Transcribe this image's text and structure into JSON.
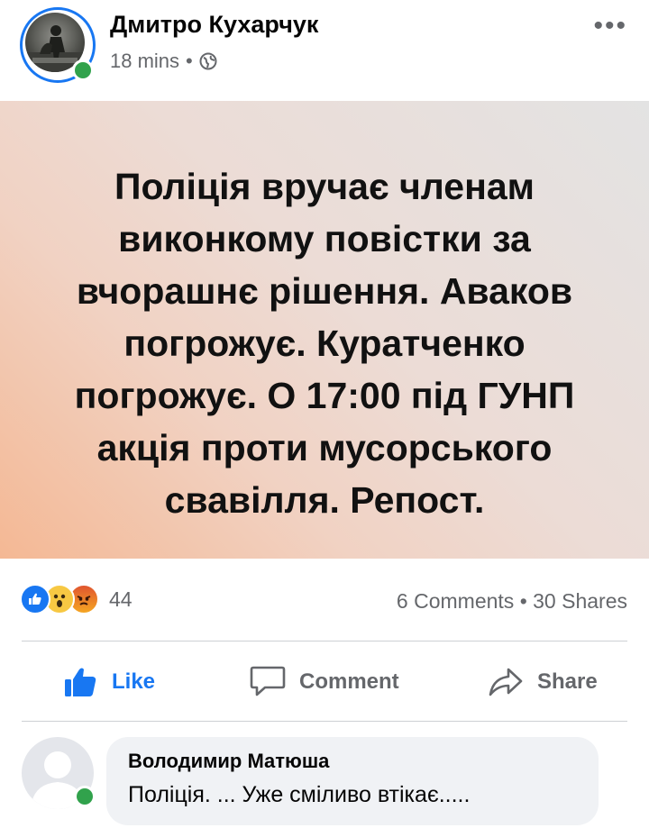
{
  "author": {
    "name": "Дмитро Кухарчук",
    "timestamp": "18 mins",
    "privacy_icon": "globe-icon"
  },
  "post": {
    "text": "Поліція вручає членам виконкому повістки за вчорашнє рішення. Аваков погрожує. Куратченко погрожує. О 17:00 під ГУНП акція проти мусорського свавілля. Репост.",
    "background_gradient": [
      "#f4b894",
      "#ecdcd6",
      "#e3e3e3"
    ]
  },
  "reactions": {
    "types": [
      "like",
      "wow",
      "angry"
    ],
    "count": "44"
  },
  "stats": {
    "comments": "6 Comments",
    "separator": "•",
    "shares": "30 Shares"
  },
  "actions": {
    "like": "Like",
    "comment": "Comment",
    "share": "Share"
  },
  "comment": {
    "author": "Володимир Матюша",
    "text": "Поліція. ... Уже  сміливо втікає....."
  },
  "colors": {
    "accent": "#1877f2",
    "online": "#31a24c",
    "secondary_text": "#65676b"
  }
}
